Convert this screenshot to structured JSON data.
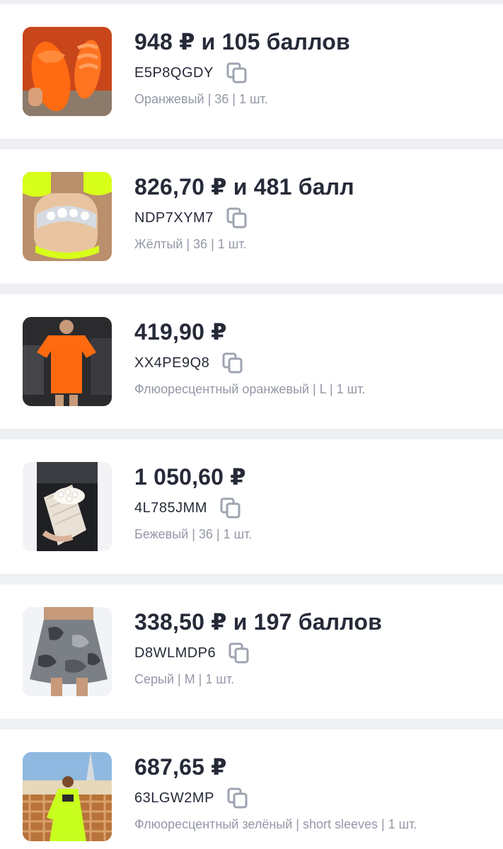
{
  "orders": [
    {
      "price": "948 ₽ и 105 баллов",
      "code": "E5P8QGDY",
      "meta": "Оранжевый | 36 | 1 шт.",
      "image": "orange-sandals",
      "image_bg": "#c8461a",
      "accent": "#ff6a12"
    },
    {
      "price": "826,70 ₽ и 481 балл",
      "code": "NDP7XYM7",
      "meta": "Жёлтый | 36 | 1 шт.",
      "image": "yellow-jeweled-sandals",
      "image_bg": "#b98f6c",
      "accent": "#d8ff1a"
    },
    {
      "price": "419,90 ₽",
      "code": "XX4PE9Q8",
      "meta": "Флюоресцентный оранжевый | L | 1 шт.",
      "image": "orange-tshirt-dress",
      "image_bg": "#2b2b2e",
      "accent": "#ff6a10"
    },
    {
      "price": "1 050,60 ₽",
      "code": "4L785JMM",
      "meta": "Бежевый | 36 | 1 шт.",
      "image": "beige-pearl-slides",
      "image_bg": "#f3f3f6",
      "accent": "#e9e1d5"
    },
    {
      "price": "338,50 ₽ и 197 баллов",
      "code": "D8WLMDP6",
      "meta": "Серый | M | 1 шт.",
      "image": "grey-camo-skirt",
      "image_bg": "#f2f3f7",
      "accent": "#7b7f86"
    },
    {
      "price": "687,65 ₽",
      "code": "63LGW2MP",
      "meta": "Флюоресцентный зелёный | short sleeves | 1 шт.",
      "image": "neon-green-beach-cover",
      "image_bg": "#8fb9e0",
      "accent": "#c8ff1e"
    }
  ],
  "colors": {
    "background": "#eef0f4",
    "card": "#ffffff",
    "text": "#262a38",
    "muted": "#9498a6",
    "icon": "#9ea3b0"
  },
  "icons": {
    "copy": "copy-icon"
  }
}
